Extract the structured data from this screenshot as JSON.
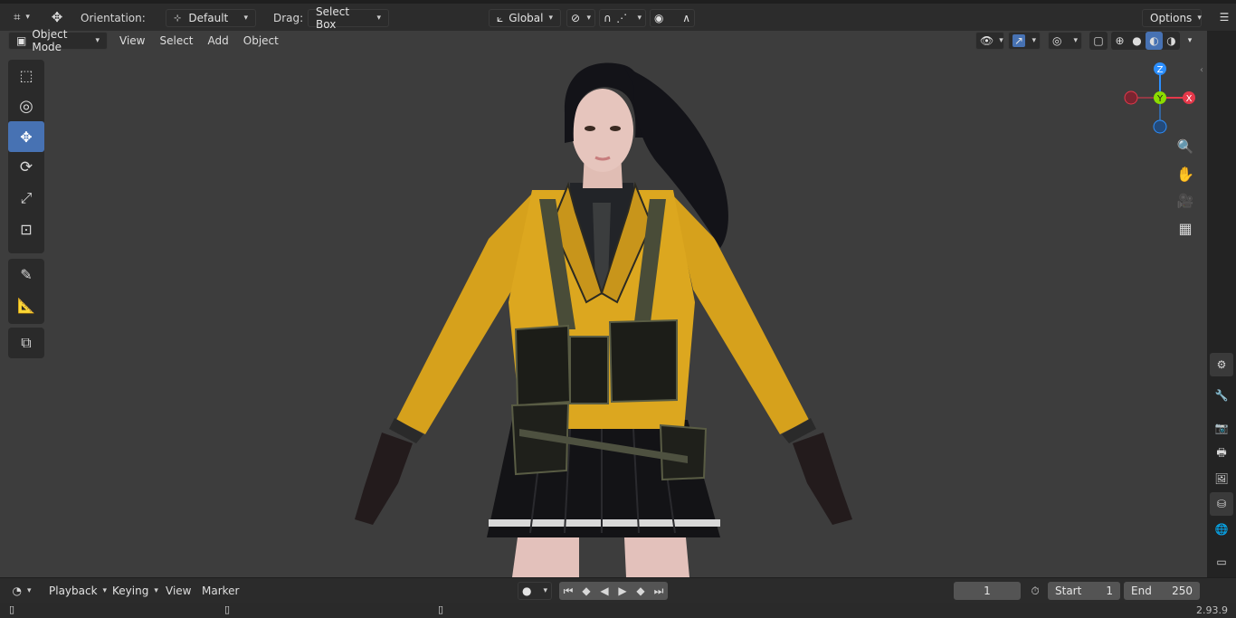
{
  "header": {
    "orientation_label": "Orientation:",
    "orientation_value": "Default",
    "drag_label": "Drag:",
    "drag_value": "Select Box",
    "transform_space": "Global",
    "options_label": "Options"
  },
  "viewport_header": {
    "mode": "Object Mode",
    "menus": [
      "View",
      "Select",
      "Add",
      "Object"
    ]
  },
  "gizmo": {
    "axis_x": "X",
    "axis_y": "Y",
    "axis_z": "Z",
    "colors": {
      "x": "#e5384a",
      "y": "#8bdc00",
      "z": "#2c8fff"
    }
  },
  "toolbar": {
    "tools": [
      "select-box-icon",
      "cursor-icon",
      "move-icon",
      "rotate-icon",
      "scale-icon",
      "transform-icon",
      "annotate-icon",
      "measure-icon",
      "add-cube-icon"
    ],
    "active_tool": "move-icon"
  },
  "timeline": {
    "menus": [
      "Playback",
      "Keying",
      "View",
      "Marker"
    ],
    "current_frame": "1",
    "start_label": "Start",
    "start_value": "1",
    "end_label": "End",
    "end_value": "250"
  },
  "status": {
    "version": "2.93.9"
  },
  "colors": {
    "accent": "#4772b3",
    "jacket": "#d9a01c",
    "hair": "#0f0f12"
  }
}
